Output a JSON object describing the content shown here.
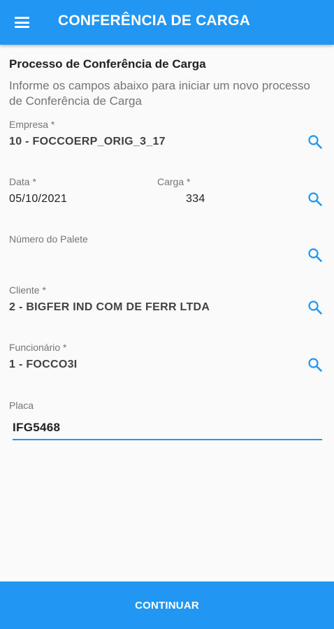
{
  "appbar": {
    "title": "CONFERÊNCIA DE CARGA",
    "menu_icon": "hamburger-menu-icon"
  },
  "form": {
    "title": "Processo de Conferência de Carga",
    "description": "Informe os campos abaixo para iniciar um novo processo de Conferência de Carga",
    "empresa": {
      "label": "Empresa *",
      "value": "10 - FOCCOERP_ORIG_3_17"
    },
    "data": {
      "label": "Data *",
      "value": "05/10/2021"
    },
    "carga": {
      "label": "Carga *",
      "value": "334"
    },
    "palete": {
      "label": "Número do Palete",
      "value": ""
    },
    "cliente": {
      "label": "Cliente *",
      "value": "2 - BIGFER IND COM DE FERR LTDA"
    },
    "funcionario": {
      "label": "Funcionário *",
      "value": "1 - FOCCO3I"
    },
    "placa": {
      "label": "Placa",
      "value": "IFG5468"
    }
  },
  "footer": {
    "continue_label": "CONTINUAR"
  },
  "colors": {
    "primary": "#2196f3",
    "label": "#757575",
    "value": "#424242"
  }
}
